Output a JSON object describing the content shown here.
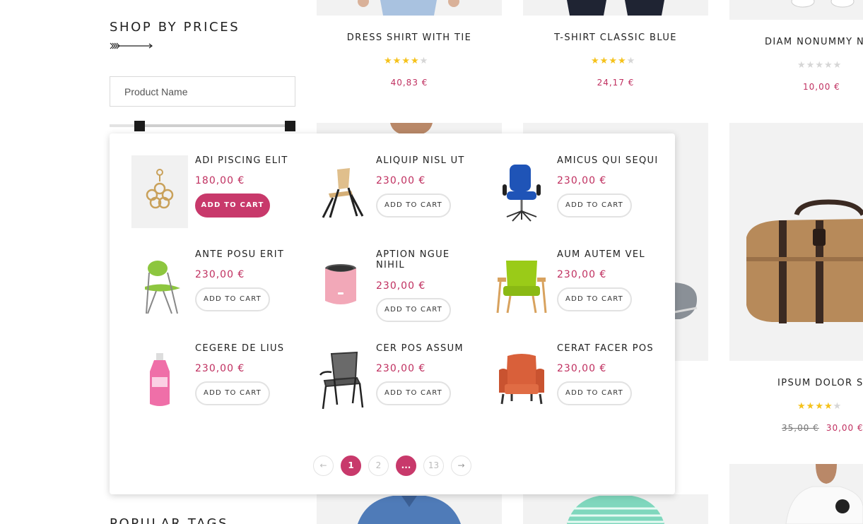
{
  "sidebar": {
    "price_title": "SHOP BY PRICES",
    "search_placeholder": "Product Name",
    "tags_title": "POPULAR TAGS"
  },
  "background_products": [
    {
      "name": "DRESS SHIRT WITH TIE",
      "price": "40,83 €",
      "rating": 4
    },
    {
      "name": "T-SHIRT CLASSIC BLUE",
      "price": "24,17 €",
      "rating": 4
    },
    {
      "name": "DIAM NONUMMY N",
      "price": "10,00 €",
      "rating": 0
    },
    {
      "name": "IPSUM DOLOR SI",
      "old_price": "35,00 €",
      "price": "30,00 €",
      "rating": 3.5
    }
  ],
  "popup": {
    "items": [
      {
        "name": "ADI PISCING ELIT",
        "price": "180,00 €",
        "button": "ADD TO CART",
        "icon": "earring-icon"
      },
      {
        "name": "ALIQUIP NISL UT",
        "price": "230,00 €",
        "button": "ADD TO CART",
        "icon": "wooden-chair-icon"
      },
      {
        "name": "AMICUS QUI SEQUI",
        "price": "230,00 €",
        "button": "ADD TO CART",
        "icon": "office-chair-icon"
      },
      {
        "name": "ANTE POSU ERIT",
        "price": "230,00 €",
        "button": "ADD TO CART",
        "icon": "green-wire-chair-icon"
      },
      {
        "name": "APTION NGUE NIHIL",
        "price": "230,00 €",
        "button": "ADD TO CART",
        "icon": "speaker-icon"
      },
      {
        "name": "AUM AUTEM VEL",
        "price": "230,00 €",
        "button": "ADD TO CART",
        "icon": "lounge-chair-icon"
      },
      {
        "name": "CEGERE DE LIUS",
        "price": "230,00 €",
        "button": "ADD TO CART",
        "icon": "bottle-icon"
      },
      {
        "name": "CER POS ASSUM",
        "price": "230,00 €",
        "button": "ADD TO CART",
        "icon": "metal-chair-icon"
      },
      {
        "name": "CERAT FACER POS",
        "price": "230,00 €",
        "button": "ADD TO CART",
        "icon": "armchair-icon"
      }
    ],
    "pagination": {
      "prev": "←",
      "pages": [
        "1",
        "2",
        "...",
        "13"
      ],
      "next": "→",
      "current": "1"
    }
  },
  "colors": {
    "accent": "#c8396b",
    "price": "#c03060",
    "star": "#f5c21b"
  }
}
